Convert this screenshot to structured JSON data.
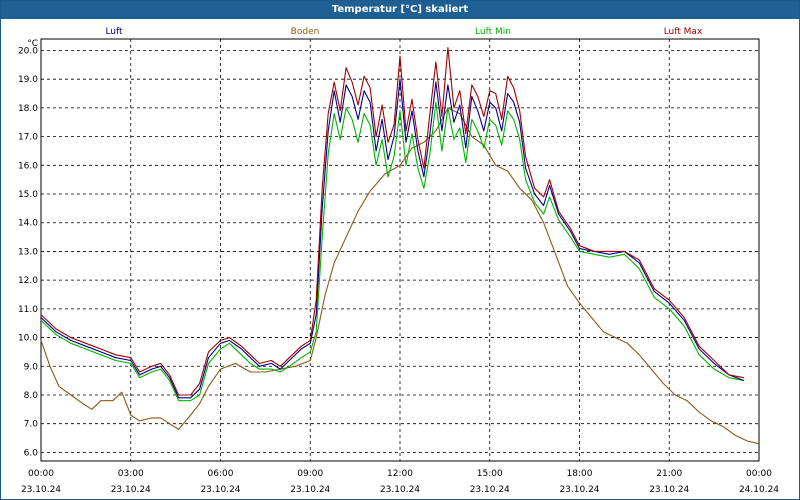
{
  "window": {
    "title": "Temperatur [°C] skaliert"
  },
  "colors": {
    "luft": "#00008c",
    "boden": "#8c5a14",
    "luft_min": "#00b400",
    "luft_max": "#a00000",
    "grid": "#000000",
    "title_bg": "#1e5f94"
  },
  "chart_data": {
    "type": "line",
    "title": "Temperatur [°C] skaliert",
    "yunit": "°C",
    "ylim": [
      5.7,
      20.4
    ],
    "y_ticks": [
      "6.0",
      "7.0",
      "8.0",
      "9.0",
      "10.0",
      "11.0",
      "12.0",
      "13.0",
      "14.0",
      "15.0",
      "16.0",
      "17.0",
      "18.0",
      "19.0",
      "20.0"
    ],
    "x_ticks": [
      {
        "time": "00:00",
        "date": "23.10.24"
      },
      {
        "time": "03:00",
        "date": "23.10.24"
      },
      {
        "time": "06:00",
        "date": "23.10.24"
      },
      {
        "time": "09:00",
        "date": "23.10.24"
      },
      {
        "time": "12:00",
        "date": "23.10.24"
      },
      {
        "time": "15:00",
        "date": "23.10.24"
      },
      {
        "time": "18:00",
        "date": "23.10.24"
      },
      {
        "time": "21:00",
        "date": "23.10.24"
      },
      {
        "time": "00:00",
        "date": "24.10.24"
      }
    ],
    "x_unit": "hours",
    "grid": true,
    "legend_position": "top",
    "series": [
      {
        "name": "Luft",
        "color_key": "luft",
        "points": [
          [
            0,
            10.7
          ],
          [
            0.5,
            10.2
          ],
          [
            1,
            9.9
          ],
          [
            1.5,
            9.7
          ],
          [
            2,
            9.5
          ],
          [
            2.5,
            9.3
          ],
          [
            3,
            9.2
          ],
          [
            3.3,
            8.7
          ],
          [
            3.7,
            8.9
          ],
          [
            4,
            9.0
          ],
          [
            4.3,
            8.6
          ],
          [
            4.6,
            7.9
          ],
          [
            5,
            7.9
          ],
          [
            5.3,
            8.2
          ],
          [
            5.6,
            9.3
          ],
          [
            6,
            9.8
          ],
          [
            6.3,
            9.9
          ],
          [
            6.7,
            9.6
          ],
          [
            7,
            9.3
          ],
          [
            7.3,
            9.0
          ],
          [
            7.7,
            9.1
          ],
          [
            8,
            8.9
          ],
          [
            8.3,
            9.2
          ],
          [
            8.7,
            9.6
          ],
          [
            9,
            9.8
          ],
          [
            9.2,
            10.8
          ],
          [
            9.4,
            14.5
          ],
          [
            9.6,
            17.2
          ],
          [
            9.8,
            18.6
          ],
          [
            10,
            17.5
          ],
          [
            10.2,
            18.8
          ],
          [
            10.4,
            18.4
          ],
          [
            10.6,
            17.6
          ],
          [
            10.8,
            18.6
          ],
          [
            11,
            18.2
          ],
          [
            11.2,
            16.5
          ],
          [
            11.4,
            17.6
          ],
          [
            11.6,
            16.2
          ],
          [
            11.8,
            17.0
          ],
          [
            12,
            19.0
          ],
          [
            12.2,
            16.8
          ],
          [
            12.4,
            17.9
          ],
          [
            12.6,
            16.5
          ],
          [
            12.8,
            15.6
          ],
          [
            13,
            17.1
          ],
          [
            13.2,
            18.9
          ],
          [
            13.4,
            17.2
          ],
          [
            13.6,
            18.8
          ],
          [
            13.8,
            17.5
          ],
          [
            14,
            18.1
          ],
          [
            14.2,
            16.6
          ],
          [
            14.4,
            18.4
          ],
          [
            14.6,
            17.9
          ],
          [
            14.8,
            17.2
          ],
          [
            15,
            18.2
          ],
          [
            15.2,
            18.0
          ],
          [
            15.4,
            17.2
          ],
          [
            15.6,
            18.5
          ],
          [
            15.8,
            18.2
          ],
          [
            16,
            17.5
          ],
          [
            16.2,
            15.9
          ],
          [
            16.5,
            15.0
          ],
          [
            16.8,
            14.6
          ],
          [
            17,
            15.3
          ],
          [
            17.3,
            14.3
          ],
          [
            17.7,
            13.7
          ],
          [
            18,
            13.1
          ],
          [
            18.5,
            13.0
          ],
          [
            19,
            12.9
          ],
          [
            19.5,
            13.0
          ],
          [
            20,
            12.6
          ],
          [
            20.5,
            11.6
          ],
          [
            21,
            11.2
          ],
          [
            21.5,
            10.6
          ],
          [
            22,
            9.6
          ],
          [
            22.5,
            9.1
          ],
          [
            23,
            8.7
          ],
          [
            23.5,
            8.5
          ]
        ]
      },
      {
        "name": "Boden",
        "color_key": "boden",
        "points": [
          [
            0,
            9.9
          ],
          [
            0.3,
            9.0
          ],
          [
            0.6,
            8.3
          ],
          [
            1,
            8.0
          ],
          [
            1.4,
            7.7
          ],
          [
            1.7,
            7.5
          ],
          [
            2,
            7.8
          ],
          [
            2.4,
            7.8
          ],
          [
            2.7,
            8.1
          ],
          [
            3,
            7.3
          ],
          [
            3.3,
            7.1
          ],
          [
            3.7,
            7.2
          ],
          [
            4,
            7.2
          ],
          [
            4.3,
            7.0
          ],
          [
            4.6,
            6.8
          ],
          [
            5,
            7.3
          ],
          [
            5.3,
            7.7
          ],
          [
            5.6,
            8.3
          ],
          [
            6,
            8.9
          ],
          [
            6.5,
            9.1
          ],
          [
            7,
            8.8
          ],
          [
            7.5,
            8.8
          ],
          [
            8,
            8.9
          ],
          [
            8.5,
            9.0
          ],
          [
            9,
            9.2
          ],
          [
            9.2,
            10.0
          ],
          [
            9.5,
            11.5
          ],
          [
            9.8,
            12.6
          ],
          [
            10.2,
            13.5
          ],
          [
            10.6,
            14.4
          ],
          [
            11,
            15.1
          ],
          [
            11.5,
            15.7
          ],
          [
            12,
            16.0
          ],
          [
            12.4,
            16.6
          ],
          [
            12.8,
            16.8
          ],
          [
            13.2,
            17.2
          ],
          [
            13.6,
            18.0
          ],
          [
            14,
            17.8
          ],
          [
            14.4,
            17.0
          ],
          [
            14.8,
            16.7
          ],
          [
            15.2,
            16.0
          ],
          [
            15.6,
            15.8
          ],
          [
            16,
            15.2
          ],
          [
            16.4,
            14.8
          ],
          [
            16.8,
            14.0
          ],
          [
            17.2,
            12.9
          ],
          [
            17.6,
            11.8
          ],
          [
            18,
            11.2
          ],
          [
            18.4,
            10.7
          ],
          [
            18.8,
            10.2
          ],
          [
            19.2,
            10.0
          ],
          [
            19.6,
            9.8
          ],
          [
            20,
            9.4
          ],
          [
            20.4,
            8.9
          ],
          [
            20.8,
            8.4
          ],
          [
            21.2,
            8.0
          ],
          [
            21.6,
            7.8
          ],
          [
            22,
            7.4
          ],
          [
            22.4,
            7.1
          ],
          [
            22.8,
            6.9
          ],
          [
            23.2,
            6.6
          ],
          [
            23.6,
            6.4
          ],
          [
            24,
            6.3
          ]
        ]
      },
      {
        "name": "Luft Min",
        "color_key": "luft_min",
        "points": [
          [
            0,
            10.6
          ],
          [
            0.5,
            10.1
          ],
          [
            1,
            9.8
          ],
          [
            1.5,
            9.6
          ],
          [
            2,
            9.4
          ],
          [
            2.5,
            9.2
          ],
          [
            3,
            9.1
          ],
          [
            3.3,
            8.6
          ],
          [
            3.7,
            8.8
          ],
          [
            4,
            8.9
          ],
          [
            4.3,
            8.5
          ],
          [
            4.6,
            7.8
          ],
          [
            5,
            7.8
          ],
          [
            5.3,
            8.0
          ],
          [
            5.6,
            9.1
          ],
          [
            6,
            9.6
          ],
          [
            6.3,
            9.8
          ],
          [
            6.7,
            9.4
          ],
          [
            7,
            9.1
          ],
          [
            7.3,
            8.9
          ],
          [
            7.7,
            8.9
          ],
          [
            8,
            8.8
          ],
          [
            8.3,
            9.0
          ],
          [
            8.7,
            9.3
          ],
          [
            9,
            9.5
          ],
          [
            9.2,
            10.2
          ],
          [
            9.4,
            13.5
          ],
          [
            9.6,
            16.4
          ],
          [
            9.8,
            17.8
          ],
          [
            10,
            16.9
          ],
          [
            10.2,
            18.0
          ],
          [
            10.4,
            17.6
          ],
          [
            10.6,
            16.8
          ],
          [
            10.8,
            17.8
          ],
          [
            11,
            17.4
          ],
          [
            11.2,
            16.0
          ],
          [
            11.4,
            16.9
          ],
          [
            11.6,
            15.6
          ],
          [
            11.8,
            16.3
          ],
          [
            12,
            17.9
          ],
          [
            12.2,
            16.0
          ],
          [
            12.4,
            17.1
          ],
          [
            12.6,
            15.9
          ],
          [
            12.8,
            15.2
          ],
          [
            13,
            16.4
          ],
          [
            13.2,
            18.2
          ],
          [
            13.4,
            16.5
          ],
          [
            13.6,
            18.0
          ],
          [
            13.8,
            16.9
          ],
          [
            14,
            17.3
          ],
          [
            14.2,
            16.1
          ],
          [
            14.4,
            17.6
          ],
          [
            14.6,
            17.2
          ],
          [
            14.8,
            16.6
          ],
          [
            15,
            17.6
          ],
          [
            15.2,
            17.4
          ],
          [
            15.4,
            16.7
          ],
          [
            15.6,
            17.9
          ],
          [
            15.8,
            17.6
          ],
          [
            16,
            16.9
          ],
          [
            16.2,
            15.5
          ],
          [
            16.5,
            14.7
          ],
          [
            16.8,
            14.3
          ],
          [
            17,
            14.9
          ],
          [
            17.3,
            14.1
          ],
          [
            17.7,
            13.5
          ],
          [
            18,
            13.0
          ],
          [
            18.5,
            12.9
          ],
          [
            19,
            12.8
          ],
          [
            19.5,
            12.9
          ],
          [
            20,
            12.4
          ],
          [
            20.5,
            11.4
          ],
          [
            21,
            11.0
          ],
          [
            21.5,
            10.4
          ],
          [
            22,
            9.4
          ],
          [
            22.5,
            8.9
          ],
          [
            23,
            8.6
          ],
          [
            23.5,
            8.5
          ]
        ]
      },
      {
        "name": "Luft Max",
        "color_key": "luft_max",
        "points": [
          [
            0,
            10.8
          ],
          [
            0.5,
            10.3
          ],
          [
            1,
            10.0
          ],
          [
            1.5,
            9.8
          ],
          [
            2,
            9.6
          ],
          [
            2.5,
            9.4
          ],
          [
            3,
            9.3
          ],
          [
            3.3,
            8.8
          ],
          [
            3.7,
            9.0
          ],
          [
            4,
            9.1
          ],
          [
            4.3,
            8.7
          ],
          [
            4.6,
            8.0
          ],
          [
            5,
            8.0
          ],
          [
            5.3,
            8.4
          ],
          [
            5.6,
            9.5
          ],
          [
            6,
            9.9
          ],
          [
            6.3,
            10.0
          ],
          [
            6.7,
            9.7
          ],
          [
            7,
            9.4
          ],
          [
            7.3,
            9.1
          ],
          [
            7.7,
            9.2
          ],
          [
            8,
            9.0
          ],
          [
            8.3,
            9.3
          ],
          [
            8.7,
            9.7
          ],
          [
            9,
            9.9
          ],
          [
            9.2,
            11.3
          ],
          [
            9.4,
            15.2
          ],
          [
            9.6,
            17.8
          ],
          [
            9.8,
            18.9
          ],
          [
            10,
            17.9
          ],
          [
            10.2,
            19.4
          ],
          [
            10.4,
            18.9
          ],
          [
            10.6,
            18.1
          ],
          [
            10.8,
            19.1
          ],
          [
            11,
            18.7
          ],
          [
            11.2,
            17.0
          ],
          [
            11.4,
            18.1
          ],
          [
            11.6,
            16.8
          ],
          [
            11.8,
            17.4
          ],
          [
            12,
            19.8
          ],
          [
            12.2,
            17.2
          ],
          [
            12.4,
            18.3
          ],
          [
            12.6,
            16.9
          ],
          [
            12.8,
            15.9
          ],
          [
            13,
            17.8
          ],
          [
            13.2,
            19.6
          ],
          [
            13.4,
            17.7
          ],
          [
            13.6,
            20.1
          ],
          [
            13.8,
            18.0
          ],
          [
            14,
            18.6
          ],
          [
            14.2,
            17.1
          ],
          [
            14.4,
            18.8
          ],
          [
            14.6,
            18.4
          ],
          [
            14.8,
            17.7
          ],
          [
            15,
            18.6
          ],
          [
            15.2,
            18.5
          ],
          [
            15.4,
            17.6
          ],
          [
            15.6,
            19.1
          ],
          [
            15.8,
            18.7
          ],
          [
            16,
            17.9
          ],
          [
            16.2,
            16.3
          ],
          [
            16.5,
            15.2
          ],
          [
            16.8,
            14.9
          ],
          [
            17,
            15.5
          ],
          [
            17.3,
            14.4
          ],
          [
            17.7,
            13.8
          ],
          [
            18,
            13.2
          ],
          [
            18.5,
            13.0
          ],
          [
            19,
            13.0
          ],
          [
            19.5,
            13.0
          ],
          [
            20,
            12.7
          ],
          [
            20.5,
            11.7
          ],
          [
            21,
            11.3
          ],
          [
            21.5,
            10.7
          ],
          [
            22,
            9.7
          ],
          [
            22.5,
            9.2
          ],
          [
            23,
            8.7
          ],
          [
            23.5,
            8.6
          ]
        ]
      }
    ]
  }
}
